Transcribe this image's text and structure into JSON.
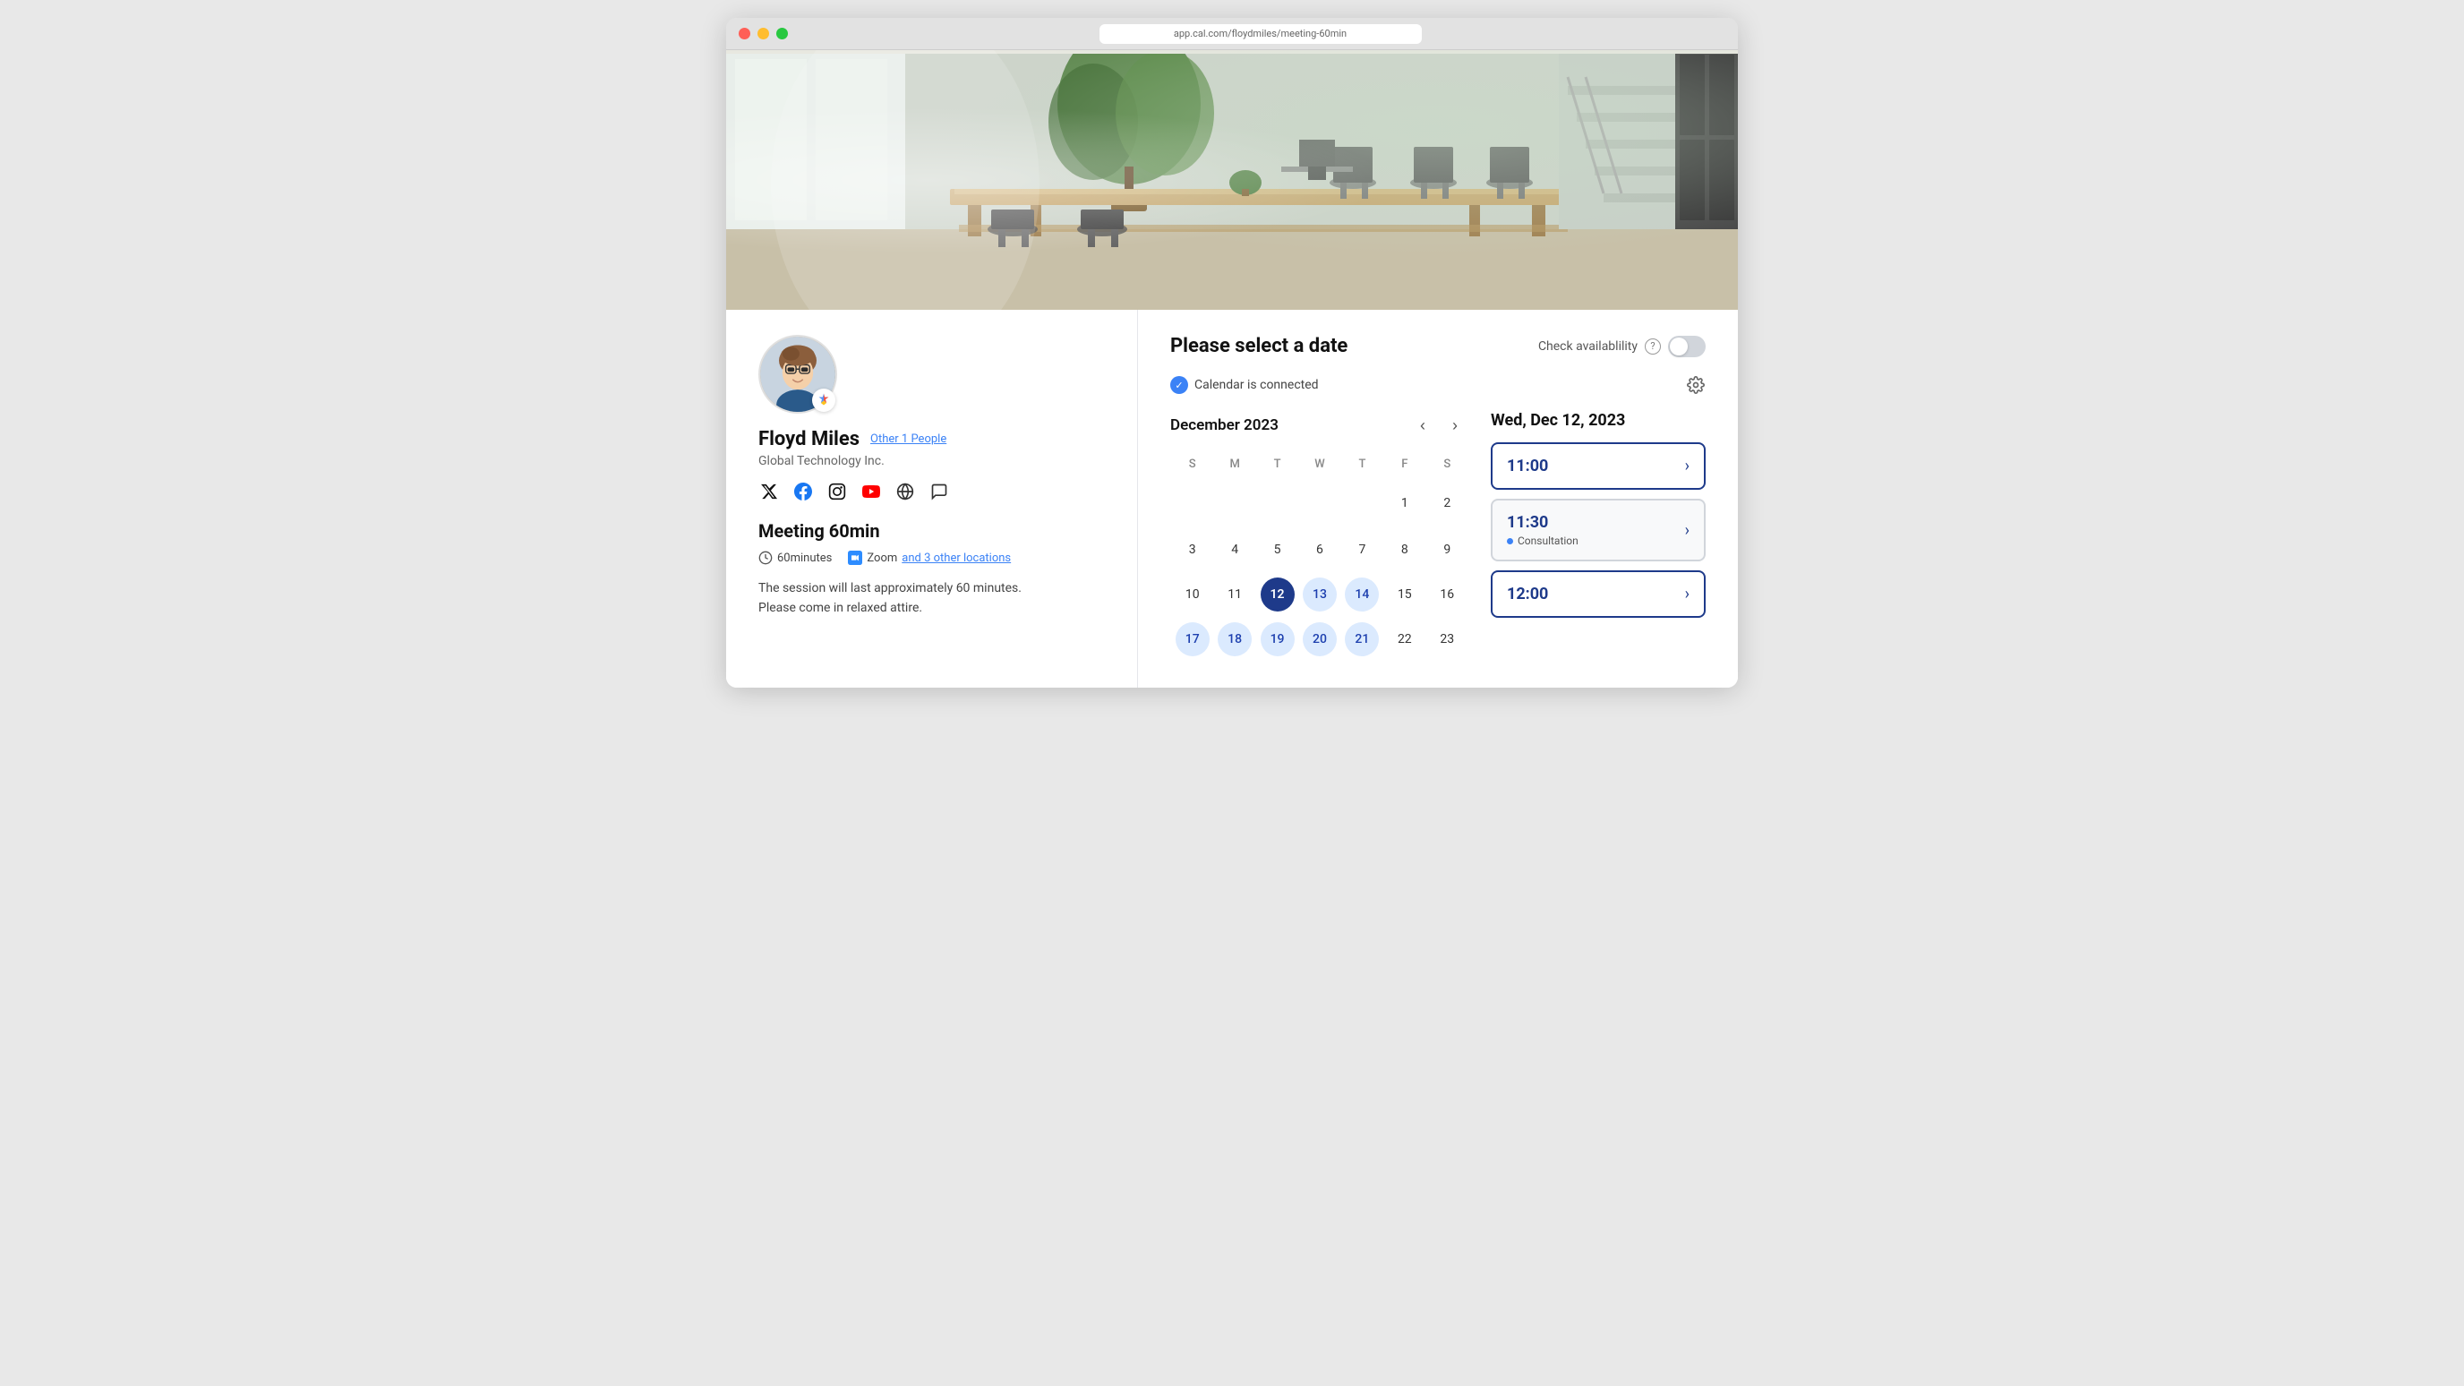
{
  "window": {
    "traffic_lights": [
      "red",
      "yellow",
      "green"
    ],
    "url_placeholder": "app.cal.com/floydmiles/meeting-60min"
  },
  "hero": {
    "alt": "Office interior with long table and chairs"
  },
  "profile": {
    "name": "Floyd Miles",
    "other_people_link": "Other 1 People",
    "company": "Global Technology Inc.",
    "google_badge": "G"
  },
  "social": {
    "twitter": "𝕏",
    "facebook": "f",
    "instagram": "▣",
    "youtube": "▶",
    "website": "⊕",
    "chat": "✉"
  },
  "meeting": {
    "title": "Meeting 60min",
    "duration": "60minutes",
    "location_icon": "zoom",
    "location_text": "Zoom",
    "location_link": "and 3 other locations",
    "description_line1": "The session will last approximately 60 minutes.",
    "description_line2": "Please come in relaxed attire."
  },
  "date_picker": {
    "title": "Please select a date",
    "check_availability_label": "Check availablility",
    "calendar_connected_label": "Calendar is connected",
    "month": "December 2023",
    "weekdays": [
      "S",
      "M",
      "T",
      "W",
      "T",
      "F",
      "S"
    ],
    "weeks": [
      [
        null,
        null,
        null,
        null,
        null,
        1,
        2
      ],
      [
        3,
        4,
        5,
        6,
        7,
        8,
        9
      ],
      [
        10,
        11,
        12,
        13,
        14,
        15,
        16
      ],
      [
        17,
        18,
        19,
        20,
        21,
        22,
        23
      ]
    ],
    "available_days": [
      12,
      13,
      14,
      17,
      18,
      19,
      20,
      21
    ],
    "selected_day": 12,
    "selected_date_label": "Wed, Dec 12, 2023"
  },
  "time_slots": [
    {
      "time": "11:00",
      "type": "normal",
      "label": "11:00"
    },
    {
      "time": "11:30",
      "type": "consultation",
      "label": "11:30",
      "badge": "Consultation"
    },
    {
      "time": "12:00",
      "type": "normal",
      "label": "12:00"
    }
  ]
}
